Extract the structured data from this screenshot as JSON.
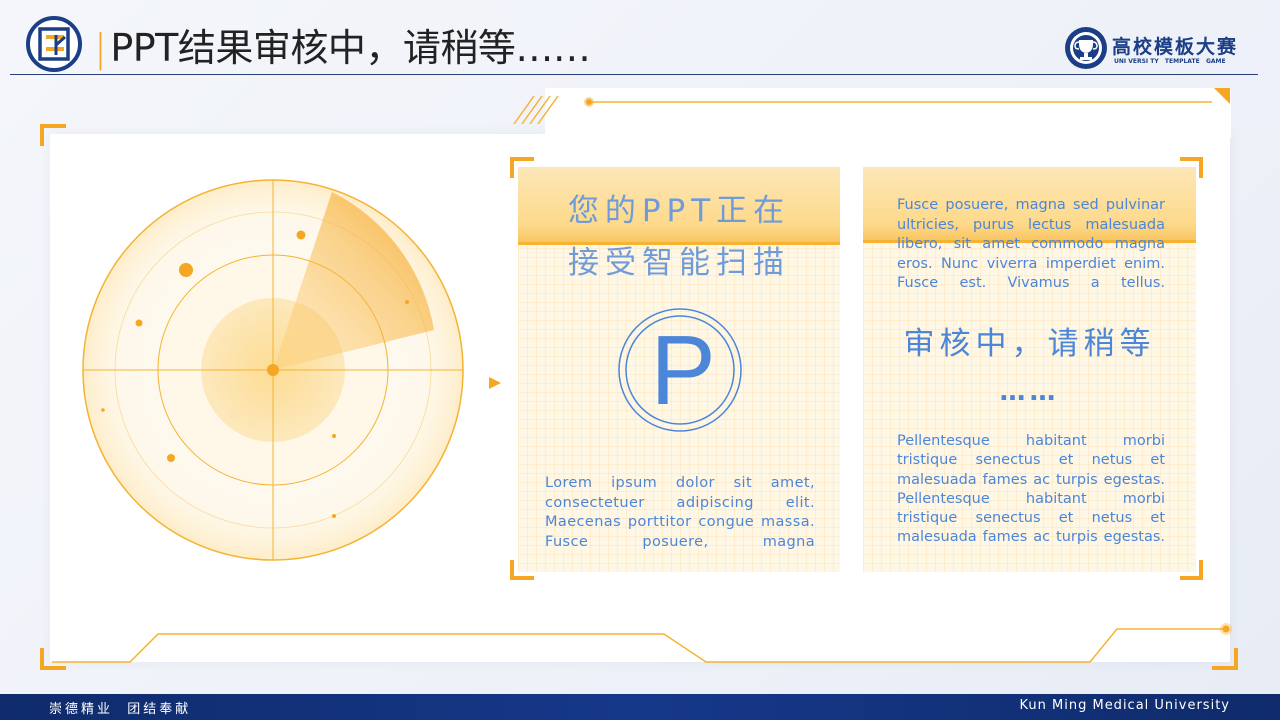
{
  "header": {
    "title": "PPT结果审核中，请稍等……",
    "title_separator": "|",
    "right_logo_name": "高校模板大赛",
    "right_logo_sub": "UNI VERSI TY   TEMPLATE   GAME"
  },
  "left_panel": {
    "scan_line1": "您的PPT正在",
    "scan_line2": "接受智能扫描",
    "badge_letter": "P",
    "body": "Lorem ipsum dolor sit amet, consectetuer adipiscing elit. Maecenas porttitor congue massa. Fusce posuere, magna"
  },
  "right_panel": {
    "top_text": "Fusce posuere, magna sed pulvinar ultricies, purus lectus malesuada libero, sit amet commodo magna eros. Nunc viverra imperdiet enim. Fusce est. Vivamus a tellus.",
    "review_title": "审核中，请稍等",
    "review_dots": "……",
    "bottom_text": "Pellentesque habitant morbi tristique senectus et netus et malesuada fames ac turpis egestas. Pellentesque habitant morbi tristique senectus et netus et malesuada fames ac turpis egestas."
  },
  "footer": {
    "motto": "崇德精业  团结奉献",
    "university": "Kun Ming Medical University"
  },
  "colors": {
    "accent": "#f5a623",
    "primary_blue": "#4b86d9",
    "navy": "#1b3e86",
    "footer_bg": "#0f2b6b"
  },
  "icons": {
    "left_logo": "university-emblem-icon",
    "right_logo": "trophy-seal-icon",
    "radar": "radar-scan-icon",
    "badge": "p-letter-badge-icon",
    "pointer": "triangle-right-icon"
  }
}
